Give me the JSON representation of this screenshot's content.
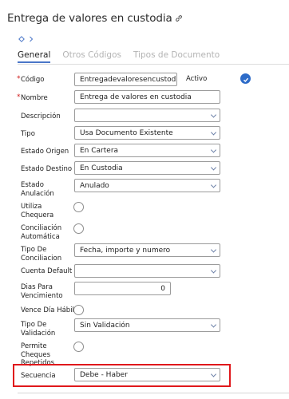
{
  "header": {
    "title": "Entrega de valores en custodia"
  },
  "tabs": [
    {
      "label": "General"
    },
    {
      "label": "Otros Códigos"
    },
    {
      "label": "Tipos de Documento"
    }
  ],
  "form": {
    "codigo": {
      "label": "Código",
      "value": "Entregadevaloresencustod"
    },
    "activo": {
      "label": "Activo",
      "checked": true
    },
    "nombre": {
      "label": "Nombre",
      "value": "Entrega de valores en custodia"
    },
    "descripcion": {
      "label": "Descripción",
      "value": ""
    },
    "tipo": {
      "label": "Tipo",
      "value": "Usa Documento Existente"
    },
    "estado_origen": {
      "label": "Estado Origen",
      "value": "En Cartera"
    },
    "estado_destino": {
      "label": "Estado Destino",
      "value": "En Custodia"
    },
    "estado_anulacion": {
      "label1": "Estado",
      "label2": "Anulación",
      "value": "Anulado"
    },
    "utiliza_chequera": {
      "label1": "Utiliza",
      "label2": "Chequera",
      "checked": false
    },
    "conciliacion_automatica": {
      "label1": "Conciliación",
      "label2": "Automática",
      "checked": false
    },
    "tipo_conciliacion": {
      "label1": "Tipo De",
      "label2": "Conciliacion",
      "value": "Fecha, importe y numero"
    },
    "cuenta_default": {
      "label": "Cuenta Default",
      "value": ""
    },
    "dias_vencimiento": {
      "label1": "Dias Para",
      "label2": "Vencimiento",
      "value": "0"
    },
    "vence_dia_habil": {
      "label": "Vence Día Hábil",
      "checked": false
    },
    "tipo_validacion": {
      "label1": "Tipo De",
      "label2": "Validación",
      "value": "Sin Validación"
    },
    "permite_repetidos": {
      "label1": "Permite",
      "label2": "Cheques",
      "label3": "Repetidos",
      "checked": false
    },
    "secuencia": {
      "label": "Secuencia",
      "value": "Debe - Haber"
    }
  },
  "colors": {
    "accent": "#4a76c8",
    "required": "#d01c1c",
    "highlight": "#e0181b",
    "check": "#2d6bc8"
  },
  "icons": {
    "title": "link-icon",
    "nav": [
      "diamond-icon",
      "chevron-right-icon"
    ],
    "activo": "checkmark-icon"
  }
}
